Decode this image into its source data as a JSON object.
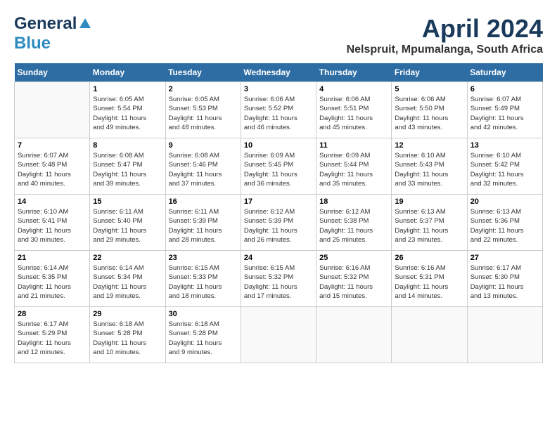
{
  "header": {
    "logo_line1": "General",
    "logo_line2": "Blue",
    "month_title": "April 2024",
    "subtitle": "Nelspruit, Mpumalanga, South Africa"
  },
  "days_of_week": [
    "Sunday",
    "Monday",
    "Tuesday",
    "Wednesday",
    "Thursday",
    "Friday",
    "Saturday"
  ],
  "weeks": [
    [
      {
        "day": "",
        "info": ""
      },
      {
        "day": "1",
        "info": "Sunrise: 6:05 AM\nSunset: 5:54 PM\nDaylight: 11 hours\nand 49 minutes."
      },
      {
        "day": "2",
        "info": "Sunrise: 6:05 AM\nSunset: 5:53 PM\nDaylight: 11 hours\nand 48 minutes."
      },
      {
        "day": "3",
        "info": "Sunrise: 6:06 AM\nSunset: 5:52 PM\nDaylight: 11 hours\nand 46 minutes."
      },
      {
        "day": "4",
        "info": "Sunrise: 6:06 AM\nSunset: 5:51 PM\nDaylight: 11 hours\nand 45 minutes."
      },
      {
        "day": "5",
        "info": "Sunrise: 6:06 AM\nSunset: 5:50 PM\nDaylight: 11 hours\nand 43 minutes."
      },
      {
        "day": "6",
        "info": "Sunrise: 6:07 AM\nSunset: 5:49 PM\nDaylight: 11 hours\nand 42 minutes."
      }
    ],
    [
      {
        "day": "7",
        "info": "Sunrise: 6:07 AM\nSunset: 5:48 PM\nDaylight: 11 hours\nand 40 minutes."
      },
      {
        "day": "8",
        "info": "Sunrise: 6:08 AM\nSunset: 5:47 PM\nDaylight: 11 hours\nand 39 minutes."
      },
      {
        "day": "9",
        "info": "Sunrise: 6:08 AM\nSunset: 5:46 PM\nDaylight: 11 hours\nand 37 minutes."
      },
      {
        "day": "10",
        "info": "Sunrise: 6:09 AM\nSunset: 5:45 PM\nDaylight: 11 hours\nand 36 minutes."
      },
      {
        "day": "11",
        "info": "Sunrise: 6:09 AM\nSunset: 5:44 PM\nDaylight: 11 hours\nand 35 minutes."
      },
      {
        "day": "12",
        "info": "Sunrise: 6:10 AM\nSunset: 5:43 PM\nDaylight: 11 hours\nand 33 minutes."
      },
      {
        "day": "13",
        "info": "Sunrise: 6:10 AM\nSunset: 5:42 PM\nDaylight: 11 hours\nand 32 minutes."
      }
    ],
    [
      {
        "day": "14",
        "info": "Sunrise: 6:10 AM\nSunset: 5:41 PM\nDaylight: 11 hours\nand 30 minutes."
      },
      {
        "day": "15",
        "info": "Sunrise: 6:11 AM\nSunset: 5:40 PM\nDaylight: 11 hours\nand 29 minutes."
      },
      {
        "day": "16",
        "info": "Sunrise: 6:11 AM\nSunset: 5:39 PM\nDaylight: 11 hours\nand 28 minutes."
      },
      {
        "day": "17",
        "info": "Sunrise: 6:12 AM\nSunset: 5:39 PM\nDaylight: 11 hours\nand 26 minutes."
      },
      {
        "day": "18",
        "info": "Sunrise: 6:12 AM\nSunset: 5:38 PM\nDaylight: 11 hours\nand 25 minutes."
      },
      {
        "day": "19",
        "info": "Sunrise: 6:13 AM\nSunset: 5:37 PM\nDaylight: 11 hours\nand 23 minutes."
      },
      {
        "day": "20",
        "info": "Sunrise: 6:13 AM\nSunset: 5:36 PM\nDaylight: 11 hours\nand 22 minutes."
      }
    ],
    [
      {
        "day": "21",
        "info": "Sunrise: 6:14 AM\nSunset: 5:35 PM\nDaylight: 11 hours\nand 21 minutes."
      },
      {
        "day": "22",
        "info": "Sunrise: 6:14 AM\nSunset: 5:34 PM\nDaylight: 11 hours\nand 19 minutes."
      },
      {
        "day": "23",
        "info": "Sunrise: 6:15 AM\nSunset: 5:33 PM\nDaylight: 11 hours\nand 18 minutes."
      },
      {
        "day": "24",
        "info": "Sunrise: 6:15 AM\nSunset: 5:32 PM\nDaylight: 11 hours\nand 17 minutes."
      },
      {
        "day": "25",
        "info": "Sunrise: 6:16 AM\nSunset: 5:32 PM\nDaylight: 11 hours\nand 15 minutes."
      },
      {
        "day": "26",
        "info": "Sunrise: 6:16 AM\nSunset: 5:31 PM\nDaylight: 11 hours\nand 14 minutes."
      },
      {
        "day": "27",
        "info": "Sunrise: 6:17 AM\nSunset: 5:30 PM\nDaylight: 11 hours\nand 13 minutes."
      }
    ],
    [
      {
        "day": "28",
        "info": "Sunrise: 6:17 AM\nSunset: 5:29 PM\nDaylight: 11 hours\nand 12 minutes."
      },
      {
        "day": "29",
        "info": "Sunrise: 6:18 AM\nSunset: 5:28 PM\nDaylight: 11 hours\nand 10 minutes."
      },
      {
        "day": "30",
        "info": "Sunrise: 6:18 AM\nSunset: 5:28 PM\nDaylight: 11 hours\nand 9 minutes."
      },
      {
        "day": "",
        "info": ""
      },
      {
        "day": "",
        "info": ""
      },
      {
        "day": "",
        "info": ""
      },
      {
        "day": "",
        "info": ""
      }
    ]
  ]
}
